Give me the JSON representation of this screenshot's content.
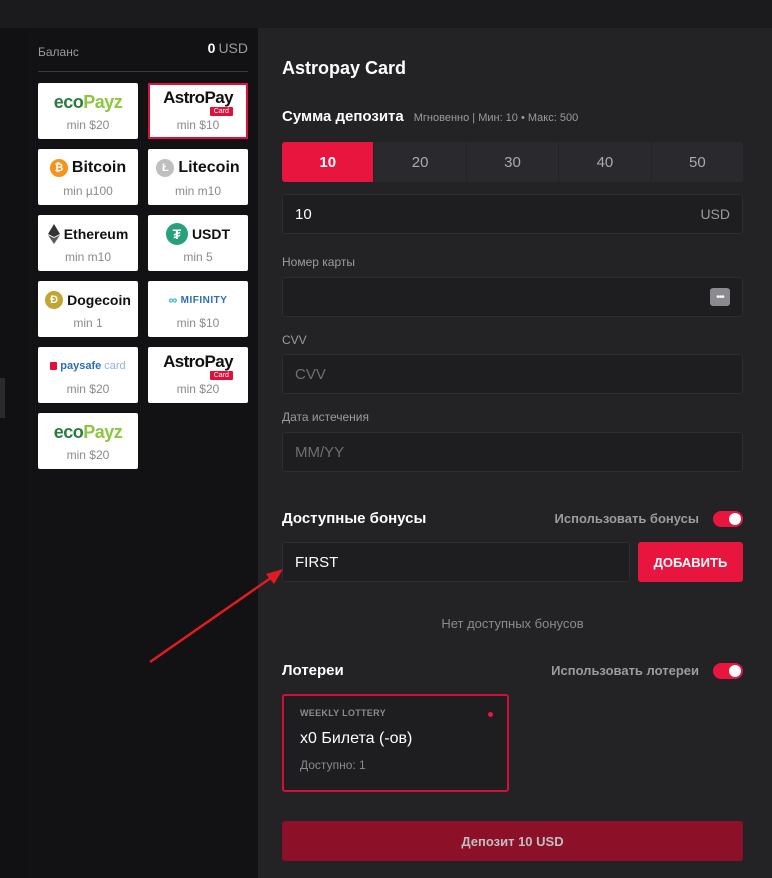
{
  "balance": {
    "label": "Баланс",
    "amount": "0",
    "currency": "USD"
  },
  "methods": [
    {
      "name": "ecoPayz",
      "min": "min $20"
    },
    {
      "name": "AstroPay",
      "badge": "Card",
      "min": "min $10",
      "selected": true
    },
    {
      "name": "Bitcoin",
      "min": "min µ100"
    },
    {
      "name": "Litecoin",
      "min": "min m10"
    },
    {
      "name": "Ethereum",
      "min": "min m10"
    },
    {
      "name": "USDT",
      "min": "min 5"
    },
    {
      "name": "Dogecoin",
      "min": "min 1"
    },
    {
      "name": "MIFINITY",
      "min": "min $10"
    },
    {
      "name": "paysafecard",
      "min": "min $20"
    },
    {
      "name": "AstroPay",
      "badge": "Card",
      "min": "min $20"
    },
    {
      "name": "ecoPayz",
      "min": "min $20"
    }
  ],
  "form": {
    "title": "Astropay Card",
    "amount_heading": "Сумма депозита",
    "amount_hint": "Мгновенно | Мин: 10 • Макс: 500",
    "presets": [
      "10",
      "20",
      "30",
      "40",
      "50"
    ],
    "active_preset": "10",
    "amount_value": "10",
    "amount_currency": "USD",
    "card_label": "Номер карты",
    "card_value": "",
    "cvv_label": "CVV",
    "cvv_placeholder": "CVV",
    "expiry_label": "Дата истечения",
    "expiry_placeholder": "MM/YY"
  },
  "bonuses": {
    "heading": "Доступные бонусы",
    "toggle_label": "Использовать бонусы",
    "toggle_on": true,
    "code_value": "FIRST",
    "add_label": "ДОБАВИТЬ",
    "empty_text": "Нет доступных бонусов"
  },
  "lotteries": {
    "heading": "Лотереи",
    "toggle_label": "Использовать лотереи",
    "toggle_on": true,
    "card": {
      "tag": "WEEKLY LOTTERY",
      "title": "x0 Билета (-ов)",
      "available": "Доступно: 1"
    }
  },
  "deposit_label": "Депозит 10 USD",
  "colors": {
    "accent": "#e8163f",
    "panel": "#232326",
    "sidebar": "#121214"
  }
}
